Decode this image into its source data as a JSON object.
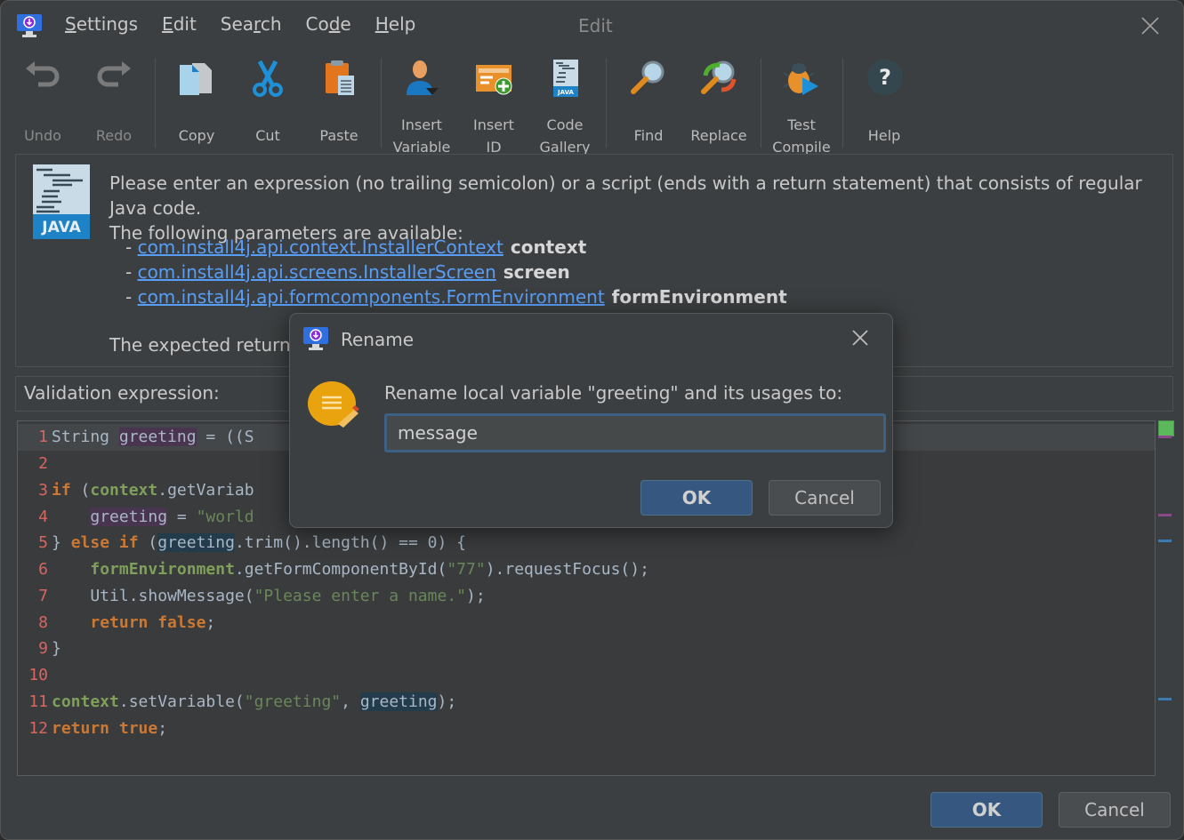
{
  "window": {
    "title": "Edit",
    "menu": [
      {
        "label": "Settings",
        "mnemonic_index": 0
      },
      {
        "label": "Edit",
        "mnemonic_index": 0
      },
      {
        "label": "Search",
        "mnemonic_index": 3
      },
      {
        "label": "Code",
        "mnemonic_index": 2
      },
      {
        "label": "Help",
        "mnemonic_index": 0
      }
    ],
    "menu_labels": [
      "Settings",
      "Edit",
      "Search",
      "Code",
      "Help"
    ]
  },
  "toolbar": {
    "undo": {
      "line1": "Undo",
      "icon": "undo-icon",
      "enabled": false
    },
    "redo": {
      "line1": "Redo",
      "icon": "redo-icon",
      "enabled": false
    },
    "copy": {
      "line1": "Copy",
      "icon": "copy-icon"
    },
    "cut": {
      "line1": "Cut",
      "icon": "scissors-icon"
    },
    "paste": {
      "line1": "Paste",
      "icon": "clipboard-icon"
    },
    "insert_variable": {
      "line1": "Insert",
      "line2": "Variable",
      "icon": "user-icon"
    },
    "insert_id": {
      "line1": "Insert",
      "line2": "ID",
      "icon": "form-add-icon"
    },
    "code_gallery": {
      "line1": "Code",
      "line2": "Gallery",
      "icon": "java-file-icon"
    },
    "find": {
      "line1": "Find",
      "icon": "magnifier-icon"
    },
    "replace": {
      "line1": "Replace",
      "icon": "replace-icon"
    },
    "test_compile": {
      "line1": "Test",
      "line2": "Compile",
      "icon": "bug-run-icon"
    },
    "help": {
      "line1": "Help",
      "icon": "help-icon"
    }
  },
  "info": {
    "line1": "Please enter an expression (no trailing semicolon) or a script (ends with a return statement) that consists of regular Java code.",
    "line2": "The following parameters are available:",
    "params": [
      {
        "type": "com.install4j.api.context.InstallerContext",
        "name": "context"
      },
      {
        "type": "com.install4j.api.screens.InstallerScreen",
        "name": "screen"
      },
      {
        "type": "com.install4j.api.formcomponents.FormEnvironment",
        "name": "formEnvironment"
      }
    ],
    "return_text": "The expected return ty",
    "icon_label": "JAVA"
  },
  "validation_label": "Validation expression:",
  "editor": {
    "lines": [
      {
        "n": "1"
      },
      {
        "n": "2"
      },
      {
        "n": "3"
      },
      {
        "n": "4"
      },
      {
        "n": "5"
      },
      {
        "n": "6"
      },
      {
        "n": "7"
      },
      {
        "n": "8"
      },
      {
        "n": "9"
      },
      {
        "n": "10"
      },
      {
        "n": "11"
      },
      {
        "n": "12"
      }
    ],
    "tokens": {
      "l1": [
        "String ",
        "greeting",
        " = ((S"
      ],
      "l3": [
        "if",
        " (",
        "context",
        ".getVariab"
      ],
      "l4": [
        "    ",
        "greeting",
        " = ",
        "\"world"
      ],
      "l5": [
        "} ",
        "else if",
        " (",
        "greeting",
        ".trim().length() == 0) {"
      ],
      "l6": [
        "    ",
        "formEnvironment",
        ".getFormComponentById(",
        "\"77\"",
        ").requestFocus();"
      ],
      "l7": [
        "    Util.showMessage(",
        "\"Please enter a name.\"",
        ");"
      ],
      "l8": [
        "    ",
        "return false",
        ";"
      ],
      "l9": [
        "}"
      ],
      "l11": [
        "context",
        ".setVariable(",
        "\"greeting\"",
        ", ",
        "greeting",
        ");"
      ],
      "l12": [
        "return true",
        ";"
      ]
    }
  },
  "footer": {
    "ok": "OK",
    "cancel": "Cancel"
  },
  "rename_dialog": {
    "title": "Rename",
    "prompt": "Rename local variable \"greeting\" and its usages to:",
    "input_value": "message",
    "ok": "OK",
    "cancel": "Cancel"
  },
  "colors": {
    "accent_button": "#365880",
    "link": "#589df6",
    "keyword": "#cc7832",
    "string": "#6a8759",
    "write_highlight": "#4a3550",
    "read_highlight": "#233c4c",
    "line_number": "#d9655f"
  }
}
